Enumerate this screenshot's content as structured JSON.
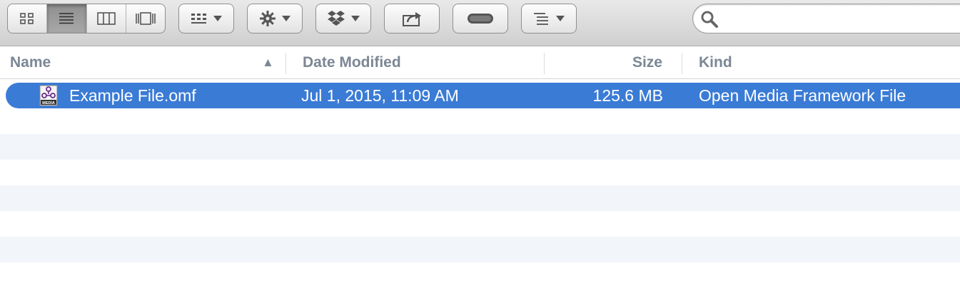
{
  "toolbar": {
    "view_modes": [
      "icon-view",
      "list-view",
      "column-view",
      "cover-flow-view"
    ],
    "active_view": "list-view",
    "buttons": [
      "arrange",
      "action",
      "dropbox",
      "share",
      "tags",
      "sort"
    ],
    "search_placeholder": ""
  },
  "columns": {
    "name": "Name",
    "date_modified": "Date Modified",
    "size": "Size",
    "kind": "Kind"
  },
  "sort_indicator": "▲",
  "files": [
    {
      "name": "Example File.omf",
      "date_modified": "Jul 1, 2015, 11:09 AM",
      "size": "125.6 MB",
      "kind": "Open Media Framework File",
      "icon": "omf-media-icon",
      "icon_label": "MEDIA",
      "selected": true
    }
  ],
  "colors": {
    "selection": "#3a7bd5",
    "header_text": "#7b8794",
    "alt_row": "#f2f5fa"
  }
}
